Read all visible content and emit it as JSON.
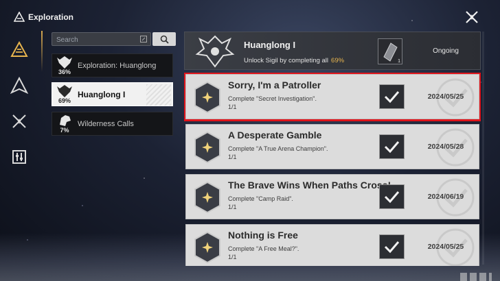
{
  "app": {
    "title": "Exploration"
  },
  "search": {
    "placeholder": "Search",
    "value": ""
  },
  "categories": [
    {
      "label": "Exploration: Huanglong",
      "percent": "36%"
    },
    {
      "label": "Huanglong I",
      "percent": "69%"
    },
    {
      "label": "Wilderness Calls",
      "percent": "7%"
    }
  ],
  "header": {
    "title": "Huanglong I",
    "subtitle": "Unlock Sigil by completing all",
    "percent": "69%",
    "sigil_count": "1",
    "status": "Ongoing"
  },
  "achievements": [
    {
      "title": "Sorry, I'm a Patroller",
      "description": "Complete \"Secret Investigation\".",
      "progress": "1/1",
      "date": "2024/05/25"
    },
    {
      "title": "A Desperate Gamble",
      "description": "Complete \"A True Arena Champion\".",
      "progress": "1/1",
      "date": "2024/05/28"
    },
    {
      "title": "The Brave Wins When Paths Cross!",
      "description": "Complete \"Camp Raid\".",
      "progress": "1/1",
      "date": "2024/06/19"
    },
    {
      "title": "Nothing is Free",
      "description": "Complete \"A Free Meal?\".",
      "progress": "1/1",
      "date": "2024/05/25"
    }
  ],
  "colors": {
    "accent_gold": "#e8b54e",
    "selection_red": "#e0141b",
    "card_bg": "#dcdcdc"
  },
  "icons": [
    "exploration-icon",
    "close-icon",
    "search-icon",
    "edit-icon",
    "checkmark-icon",
    "star-badge-icon"
  ]
}
